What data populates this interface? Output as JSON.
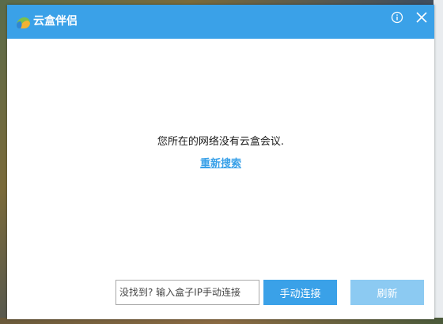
{
  "window": {
    "title": "云盒伴侣"
  },
  "main": {
    "message": "您所在的网络没有云盒会议.",
    "rescan_label": "重新搜索"
  },
  "footer": {
    "ip_placeholder": "没找到? 输入盒子IP手动连接",
    "connect_label": "手动连接",
    "refresh_label": "刷新"
  },
  "colors": {
    "accent": "#3aa1e8",
    "accent_light": "#8ccaf2"
  }
}
